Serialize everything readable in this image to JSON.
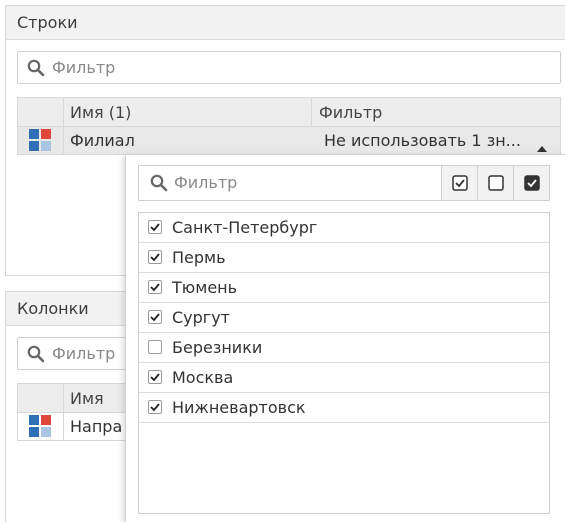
{
  "rows_panel": {
    "title": "Строки",
    "search_placeholder": "Фильтр",
    "grid": {
      "headers": [
        "Имя (1)",
        "Фильтр"
      ],
      "row": {
        "name": "Филиал",
        "filter": "Не использовать 1 зн..."
      }
    }
  },
  "columns_panel": {
    "title": "Колонки",
    "search_placeholder": "Фильтр",
    "grid": {
      "headers": [
        "Имя"
      ],
      "row": {
        "name": "Напра"
      }
    }
  },
  "dropdown": {
    "search_placeholder": "Фильтр",
    "items": [
      {
        "label": "Санкт-Петербург",
        "checked": true
      },
      {
        "label": "Пермь",
        "checked": true
      },
      {
        "label": "Тюмень",
        "checked": true
      },
      {
        "label": "Сургут",
        "checked": true
      },
      {
        "label": "Березники",
        "checked": false
      },
      {
        "label": "Москва",
        "checked": true
      },
      {
        "label": "Нижневартовск",
        "checked": true
      }
    ]
  },
  "colors": {
    "icon_red": "#e0473c",
    "icon_blue": "#2f6fb5",
    "icon_light": "#a9c4e0",
    "header_bg": "#f2f2f2",
    "selected_row": "#e8e8e8"
  }
}
